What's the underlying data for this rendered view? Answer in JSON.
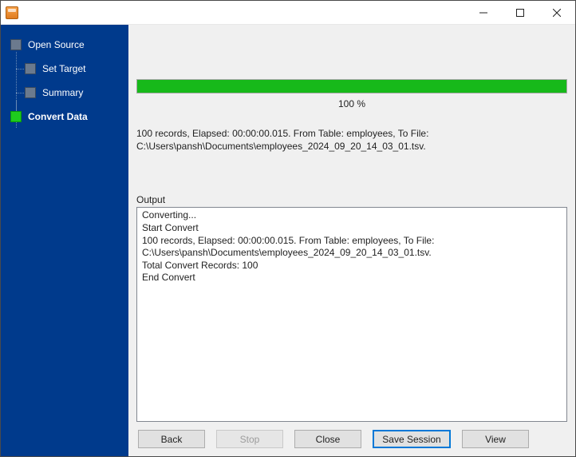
{
  "sidebar": {
    "items": [
      {
        "label": "Open Source",
        "root": true,
        "active": false
      },
      {
        "label": "Set Target",
        "root": false,
        "active": false
      },
      {
        "label": "Summary",
        "root": false,
        "active": false
      },
      {
        "label": "Convert Data",
        "root": true,
        "active": true
      }
    ]
  },
  "progress": {
    "percent_label": "100 %",
    "value": 100
  },
  "status_line1": "100 records,    Elapsed: 00:00:00.015.    From Table: employees,    To File:",
  "status_line2": "C:\\Users\\pansh\\Documents\\employees_2024_09_20_14_03_01.tsv.",
  "output": {
    "label": "Output",
    "lines": [
      "Converting...",
      "Start Convert",
      "100 records,    Elapsed: 00:00:00.015.    From Table: employees,    To File: C:\\Users\\pansh\\Documents\\employees_2024_09_20_14_03_01.tsv.",
      "Total Convert Records: 100",
      "End Convert"
    ]
  },
  "buttons": {
    "back": "Back",
    "stop": "Stop",
    "close": "Close",
    "save_session": "Save Session",
    "view": "View"
  }
}
